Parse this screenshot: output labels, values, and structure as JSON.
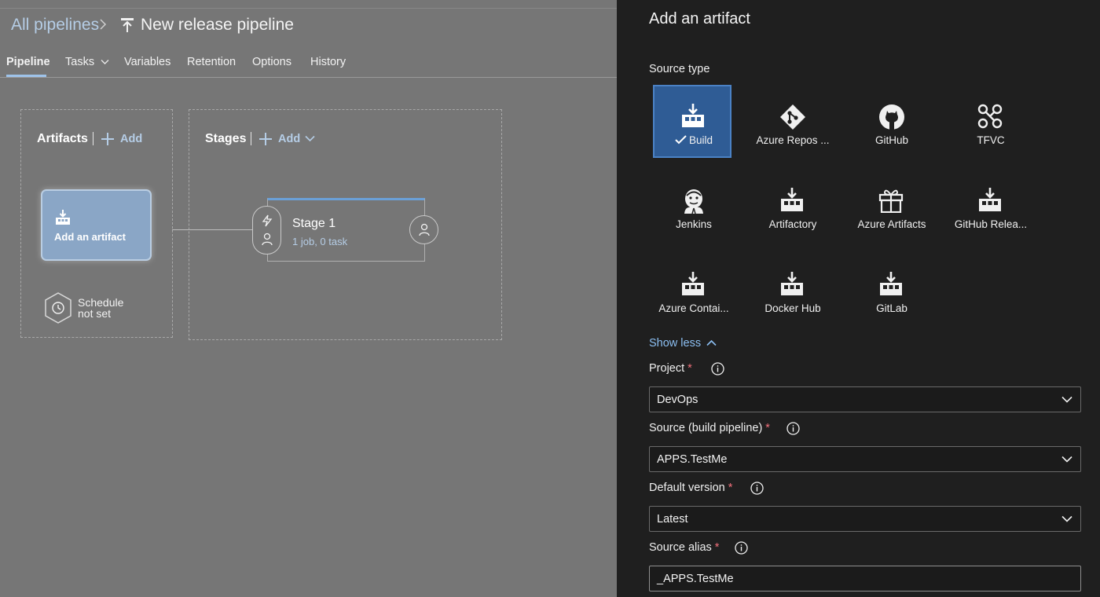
{
  "breadcrumb": {
    "all_pipelines": "All pipelines",
    "separator": ">",
    "title": "New release pipeline",
    "title_icon": "release-pipeline-icon"
  },
  "tabs": [
    {
      "label": "Pipeline",
      "selected": true
    },
    {
      "label": "Tasks",
      "has_dropdown": true
    },
    {
      "label": "Variables"
    },
    {
      "label": "Retention"
    },
    {
      "label": "Options"
    },
    {
      "label": "History"
    }
  ],
  "artifacts": {
    "title": "Artifacts",
    "add_label": "Add",
    "card_label": "Add an artifact",
    "card_icon": "build-artifact-icon",
    "schedule_line1": "Schedule",
    "schedule_line2": "not set",
    "schedule_icon": "clock-icon"
  },
  "stages": {
    "title": "Stages",
    "add_label": "Add",
    "stage": {
      "name": "Stage 1",
      "meta": "1 job, 0 task"
    },
    "pre_icons": [
      "lightning-icon",
      "person-icon"
    ],
    "post_icon": "person-icon"
  },
  "panel": {
    "title": "Add an artifact",
    "source_type_label": "Source type",
    "source_types": [
      {
        "label": "Build",
        "icon": "build-icon",
        "selected": true
      },
      {
        "label": "Azure Repos ...",
        "icon": "azure-repos-icon"
      },
      {
        "label": "GitHub",
        "icon": "github-icon"
      },
      {
        "label": "TFVC",
        "icon": "tfvc-icon"
      },
      {
        "label": "Jenkins",
        "icon": "jenkins-icon"
      },
      {
        "label": "Artifactory",
        "icon": "artifactory-icon"
      },
      {
        "label": "Azure Artifacts",
        "icon": "azure-artifacts-icon"
      },
      {
        "label": "GitHub Relea...",
        "icon": "github-release-icon"
      },
      {
        "label": "Azure Contai...",
        "icon": "azure-container-icon"
      },
      {
        "label": "Docker Hub",
        "icon": "docker-hub-icon"
      },
      {
        "label": "GitLab",
        "icon": "gitlab-icon"
      }
    ],
    "show_less": "Show less",
    "project": {
      "label": "Project",
      "value": "DevOps"
    },
    "source": {
      "label": "Source (build pipeline)",
      "value": "APPS.TestMe"
    },
    "default_version": {
      "label": "Default version",
      "value": "Latest"
    },
    "source_alias": {
      "label": "Source alias",
      "value": "_APPS.TestMe"
    },
    "required_mark": "*"
  },
  "colors": {
    "accent": "#2f5c95",
    "link": "#8cbff2",
    "required": "#f1707b",
    "panel_bg": "#1f1f1f",
    "overlay_bg": "#767676"
  }
}
